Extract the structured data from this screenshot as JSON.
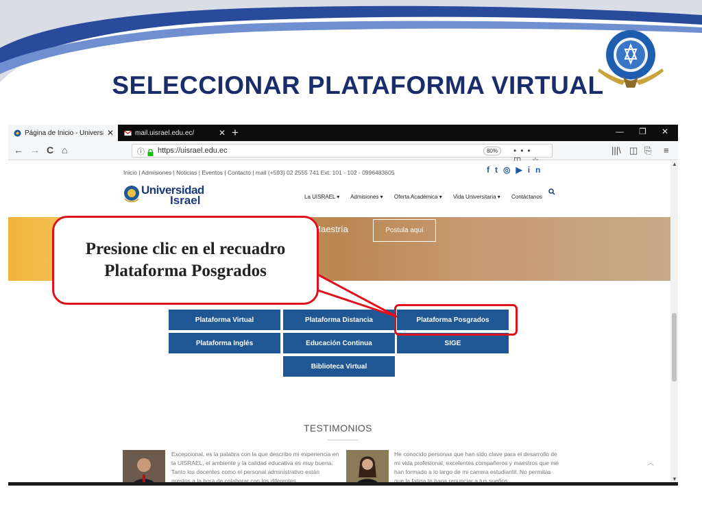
{
  "slide": {
    "title": "SELECCIONAR PLATAFORMA VIRTUAL",
    "callout": "Presione clic en el recuadro  Plataforma Posgrados",
    "colors": {
      "title": "#1a2d6b",
      "highlight": "#e0101a",
      "button": "#1f5694"
    }
  },
  "browser": {
    "tabs": [
      {
        "label": "Página de Inicio - Universidad I",
        "icon": "uisrael-favicon-icon",
        "active": true
      },
      {
        "label": "mail.uisrael.edu.ec/",
        "icon": "mail-favicon-icon",
        "active": false
      }
    ],
    "new_tab": "+",
    "window_controls": {
      "minimize": "—",
      "restore": "❐",
      "close": "✕"
    },
    "nav": {
      "back": "←",
      "forward": "→",
      "reload": "C",
      "home": "⌂"
    },
    "url": "https://uisrael.edu.ec",
    "zoom": "80%",
    "url_actions": "••• ◫ ☆",
    "toolbar_icons": {
      "library": "|||\\",
      "sidebar": "◫",
      "screenshot": "⎘",
      "menu": "≡"
    }
  },
  "site": {
    "top_links": "Inicio | Admisiones | Noticias | Eventos | Contacto | mail   (+593) 02 2555 741 Ext: 101 - 102 -  0996483605",
    "social": [
      "f",
      "t",
      "◎",
      "▶",
      "in"
    ],
    "logo": {
      "line1": "Universidad",
      "line2": "Israel"
    },
    "menu": [
      "La UISRAEL  ▾",
      "Admisiones  ▾",
      "Oferta Académica  ▾",
      "Vida Universitaria  ▾",
      "Contáctanos"
    ],
    "banner": {
      "text": "Programas de Maestría",
      "button": "Postula aquí"
    },
    "platform_buttons": [
      "Plataforma Virtual",
      "Plataforma Distancia",
      "Plataforma Posgrados",
      "Plataforma Inglés",
      "Educación Continua",
      "SIGE",
      "Biblioteca Virtual"
    ],
    "testimonials_title": "TESTIMONIOS",
    "testimonials": [
      "Excepcional, es la palabra con la que describo mi experiencia en la UISRAEL, el ambiente y la calidad educativa es muy buena. Tanto los docentes como el personal administrativo están prestos a la hora de colaborar con los diferentes",
      "He conocido personas que han sido clave para el desarrollo de mi vida profesional, excelentes compañeros y maestros que me han formado a lo largo de mi carrera estudiantil. No permitas que la fatiga te haga renunciar a tus sueños"
    ]
  }
}
